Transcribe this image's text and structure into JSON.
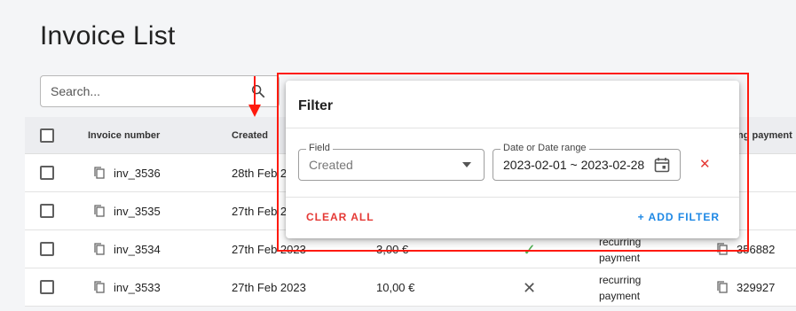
{
  "page": {
    "title": "Invoice List"
  },
  "search": {
    "placeholder": "Search..."
  },
  "table": {
    "columns": [
      "Invoice number",
      "Created",
      "ing payment I"
    ],
    "rows": [
      {
        "number": "inv_3536",
        "created": "28th Feb 20",
        "amount": "",
        "status": "",
        "type": "",
        "payment_id": ""
      },
      {
        "number": "inv_3535",
        "created": "27th Feb 20",
        "amount": "",
        "status": "",
        "type": "",
        "payment_id": ""
      },
      {
        "number": "inv_3534",
        "created": "27th Feb 2023",
        "amount": "3,00 €",
        "status": "✓",
        "type": "recurring payment",
        "payment_id": "356882"
      },
      {
        "number": "inv_3533",
        "created": "27th Feb 2023",
        "amount": "10,00 €",
        "status": "✕",
        "type": "recurring payment",
        "payment_id": "329927"
      }
    ]
  },
  "filter_dialog": {
    "title": "Filter",
    "field_label": "Field",
    "field_value": "Created",
    "date_label": "Date or Date range",
    "date_value": "2023-02-01 ~ 2023-02-28",
    "remove_glyph": "✕",
    "clear_all": "CLEAR ALL",
    "add_filter": "+ ADD FILTER"
  },
  "colors": {
    "highlight": "#ff1a0e",
    "clear_all": "#e53935",
    "add_filter": "#1e88e5",
    "success": "#4caf50"
  },
  "icons": {
    "search": "search-icon",
    "copy": "copy-icon",
    "calendar": "calendar-icon",
    "dropdown": "dropdown-arrow-icon"
  }
}
